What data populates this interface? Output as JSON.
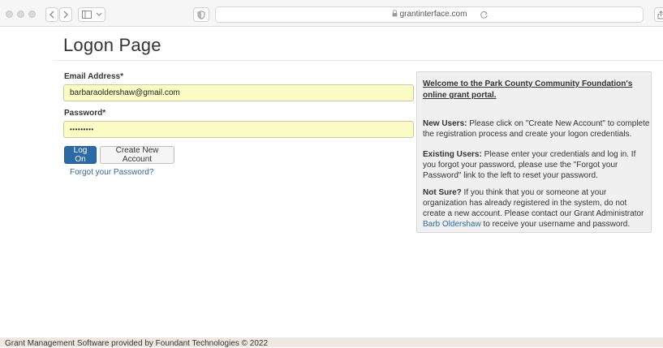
{
  "browser": {
    "url": "grantinterface.com"
  },
  "page": {
    "title": "Logon Page"
  },
  "form": {
    "email_label": "Email Address*",
    "email_value": "barbaraoldershaw@gmail.com",
    "password_label": "Password*",
    "password_value": "•••••••••",
    "logon_button": "Log On",
    "create_account_button": "Create New Account",
    "forgot_link": "Forgot your Password?"
  },
  "info": {
    "welcome": "Welcome to the Park County Community Foundation's online grant portal.",
    "new_users_heading": "New Users:",
    "new_users_text": " Please click on \"Create New Account\" to complete the registration process and create your logon credentials.",
    "existing_users_heading": "Existing Users:",
    "existing_users_text": " Please enter your credentials and log in. If you forgot your password, please use the \"Forgot your Password\" link to the left to reset your password.",
    "not_sure_heading": "Not Sure?",
    "not_sure_text_1": " If you think that you or someone at your organization has already registered in the system, do not create a new account. Please contact our Grant Administrator ",
    "admin_link": "Barb Oldershaw",
    "not_sure_text_2": " to receive your username and password."
  },
  "footer": {
    "text": "Grant Management Software provided by Foundant Technologies © 2022"
  },
  "colors": {
    "primary": "#2a6aa6",
    "input_highlight": "#fbfcc4",
    "panel_bg": "#f0f0f0",
    "footer_bg": "#efe8e0"
  }
}
